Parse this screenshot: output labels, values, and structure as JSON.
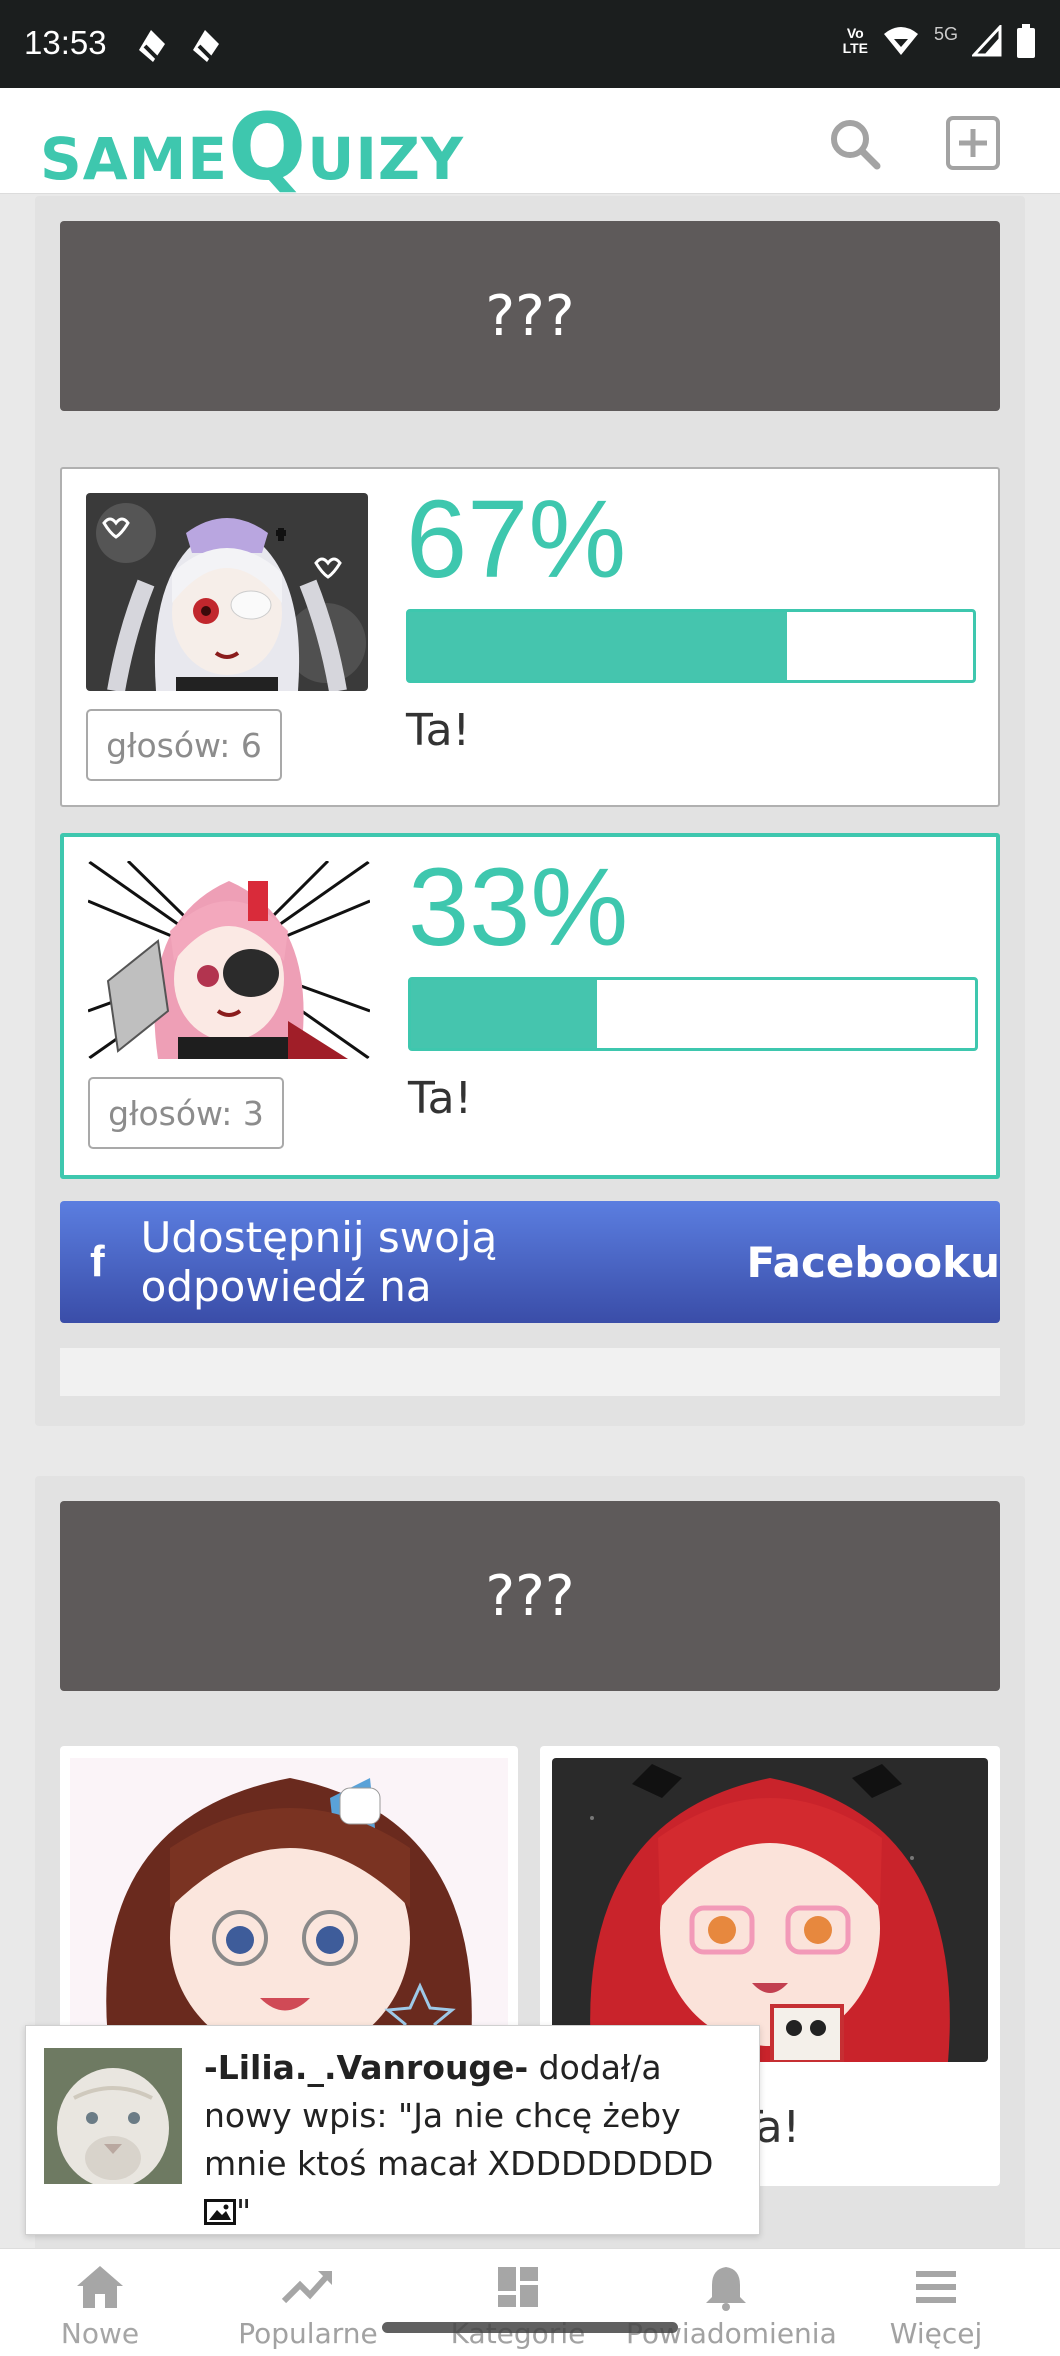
{
  "status_bar": {
    "time": "13:53",
    "network": "5G",
    "volte_line1": "Vo",
    "volte_line2": "LTE"
  },
  "header": {
    "logo_small_1": "SAME",
    "logo_big": "Q",
    "logo_small_2": "UIZY"
  },
  "question1": {
    "title": "???",
    "answers": [
      {
        "percent": "67%",
        "percent_value": 0.67,
        "votes_label": "głosów: 6",
        "text": "Ta!"
      },
      {
        "percent": "33%",
        "percent_value": 0.33,
        "votes_label": "głosów: 3",
        "text": "Ta!",
        "selected": true
      }
    ],
    "share_prefix": "Udostępnij swoją odpowiedź na",
    "share_brand": "Facebooku"
  },
  "question2": {
    "title": "???",
    "answers": [
      {
        "text": ""
      },
      {
        "text": "Ta!"
      }
    ]
  },
  "notification": {
    "user": "-Lilia._.Vanrouge-",
    "message_before": " dodał/a nowy wpis: \"Ja nie chcę żeby mnie ktoś macał XDDDDDDDD ",
    "message_after": "\""
  },
  "bottom_nav": [
    {
      "label": "Nowe",
      "icon": "home-icon"
    },
    {
      "label": "Popularne",
      "icon": "trending-icon"
    },
    {
      "label": "Kategorie",
      "icon": "grid-icon"
    },
    {
      "label": "Powiadomienia",
      "icon": "bell-icon"
    },
    {
      "label": "Więcej",
      "icon": "menu-icon"
    }
  ],
  "colors": {
    "accent": "#3ec7ae",
    "question_bg": "#5e5a5a",
    "facebook": "#4a63c8"
  }
}
